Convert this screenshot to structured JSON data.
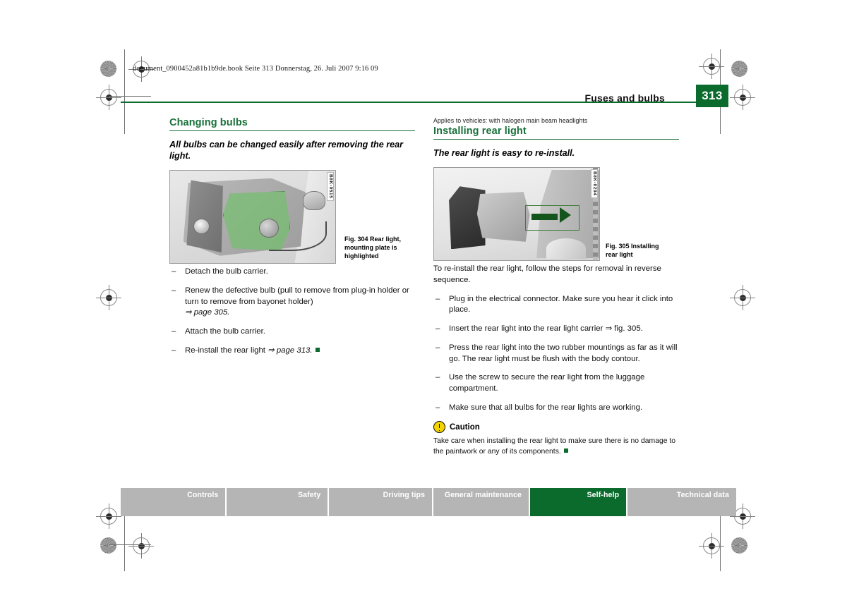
{
  "print_header": {
    "doc_line": "document_0900452a81b1b9de.book  Seite 313  Donnerstag, 26. Juli 2007  9:16 09"
  },
  "header": {
    "title": "Fuses and bulbs",
    "page_number": "313",
    "accent_color": "#0a6b2d"
  },
  "left_column": {
    "heading": "Changing bulbs",
    "subhead": "All bulbs can be changed easily after removing the rear light.",
    "figure": {
      "code": "B8K-0515",
      "caption_label": "Fig. 304",
      "caption_text": "Rear light, mounting plate is highlighted",
      "caption_full": "Fig. 304   Rear light, mounting plate is highlighted"
    },
    "steps": [
      "Detach the bulb carrier.",
      "Renew the defective bulb (pull to remove from plug-in holder or turn to remove from bayonet holder)",
      "Attach the bulb carrier.",
      "Re-install the rear light"
    ],
    "step2_reference": "⇒ page 305.",
    "step4_reference": "⇒ page 313.",
    "dash": "–"
  },
  "right_column": {
    "applies_to": "Applies to vehicles: with halogen main beam headlights",
    "heading": "Installing rear light",
    "subhead": "The rear light is easy to re-install.",
    "figure": {
      "code": "B8K-0294",
      "caption_label": "Fig. 305",
      "caption_text": "Installing rear light",
      "caption_full": "Fig. 305   Installing rear light"
    },
    "intro": "To re-install the rear light, follow the steps for removal in reverse sequence.",
    "steps": [
      "Plug in the electrical connector. Make sure you hear it click into place.",
      "Insert the rear light into the rear light carrier ⇒ fig. 305.",
      "Press the rear light into the two rubber mountings as far as it will go. The rear light must be flush with the body contour.",
      "Use the screw to secure the rear light from the luggage compartment.",
      "Make sure that all bulbs for the rear lights are working."
    ],
    "caution": {
      "label": "Caution",
      "text": "Take care when installing the rear light to make sure there is no damage to the paintwork or any of its components."
    },
    "dash": "–"
  },
  "footer": {
    "tabs": [
      {
        "label": "Controls",
        "active": false
      },
      {
        "label": "Safety",
        "active": false
      },
      {
        "label": "Driving tips",
        "active": false
      },
      {
        "label": "General maintenance",
        "active": false
      },
      {
        "label": "Self-help",
        "active": true
      },
      {
        "label": "Technical data",
        "active": false
      }
    ],
    "active_color": "#0a6b2d",
    "inactive_color": "#b5b5b5"
  }
}
